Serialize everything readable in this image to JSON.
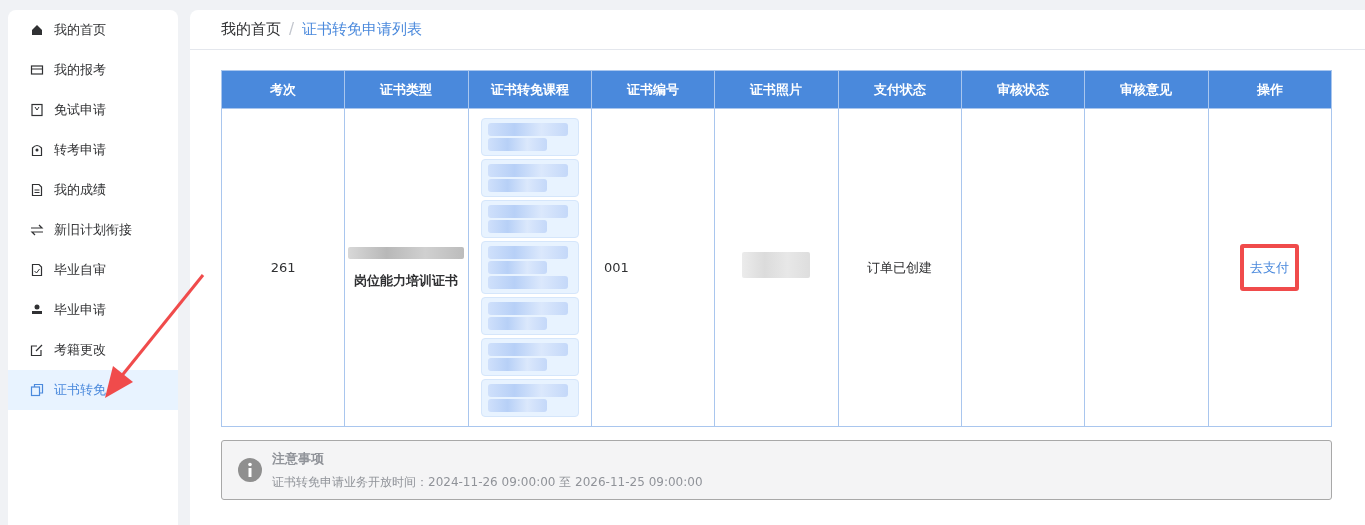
{
  "sidebar": {
    "items": [
      {
        "label": "我的首页",
        "selected": false
      },
      {
        "label": "我的报考",
        "selected": false
      },
      {
        "label": "免试申请",
        "selected": false
      },
      {
        "label": "转考申请",
        "selected": false
      },
      {
        "label": "我的成绩",
        "selected": false
      },
      {
        "label": "新旧计划衔接",
        "selected": false
      },
      {
        "label": "毕业自审",
        "selected": false
      },
      {
        "label": "毕业申请",
        "selected": false
      },
      {
        "label": "考籍更改",
        "selected": false
      },
      {
        "label": "证书转免",
        "selected": true
      }
    ]
  },
  "breadcrumb": {
    "separator": "/",
    "items": [
      {
        "label": "我的首页",
        "current": false
      },
      {
        "label": "证书转免申请列表",
        "current": true
      }
    ]
  },
  "table": {
    "columns": [
      "考次",
      "证书类型",
      "证书转免课程",
      "证书编号",
      "证书照片",
      "支付状态",
      "审核状态",
      "审核意见",
      "操作"
    ],
    "rows": [
      {
        "exam": "261",
        "cert_type": "岗位能力培训证书",
        "courses": [
          {
            "kind": "redacted"
          },
          {
            "kind": "redacted"
          },
          {
            "kind": "redacted"
          },
          {
            "kind": "redacted"
          },
          {
            "kind": "redacted"
          },
          {
            "kind": "redacted"
          },
          {
            "kind": "redacted"
          }
        ],
        "cert_no": "001",
        "pay_status": "订单已创建",
        "action": "去支付"
      }
    ]
  },
  "notice": {
    "title": "注意事项",
    "text": "证书转免申请业务开放时间：2024-11-26 09:00:00 至 2026-11-25 09:00:00"
  }
}
